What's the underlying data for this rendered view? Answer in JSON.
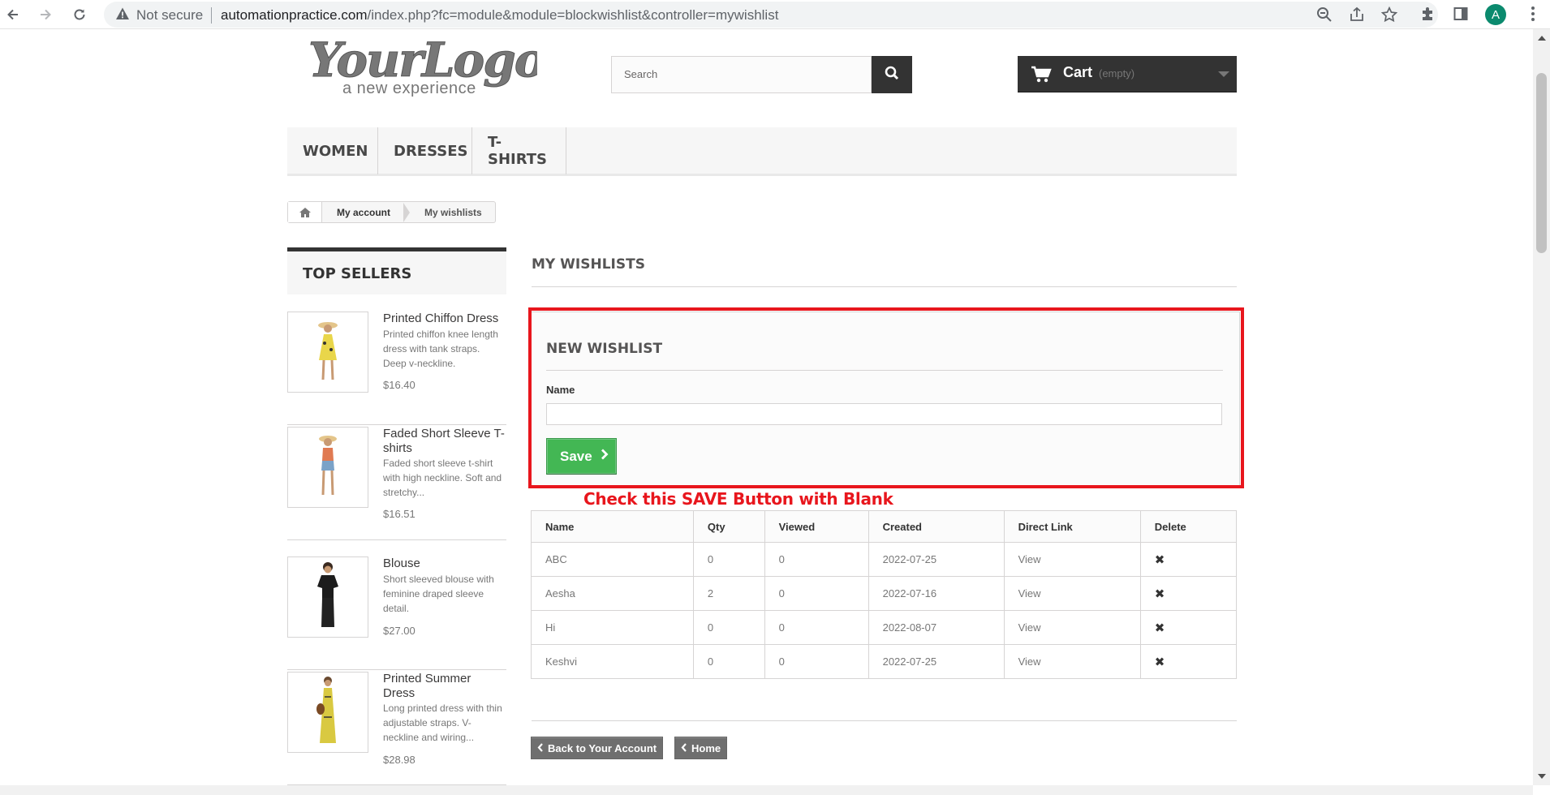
{
  "browser": {
    "security_label": "Not secure",
    "url_host": "automationpractice.com",
    "url_path": "/index.php?fc=module&module=blockwishlist&controller=mywishlist",
    "avatar_letter": "A"
  },
  "header": {
    "logo_main": "YourLogo",
    "logo_sub": "a new experience",
    "search_placeholder": "Search",
    "cart_label": "Cart",
    "cart_status": "(empty)"
  },
  "menu": [
    "WOMEN",
    "DRESSES",
    "T-SHIRTS"
  ],
  "breadcrumb": [
    "My account",
    "My wishlists"
  ],
  "sidebar": {
    "title": "TOP SELLERS",
    "products": [
      {
        "name": "Printed Chiffon Dress",
        "desc": "Printed chiffon knee length dress with tank straps. Deep v-neckline.",
        "price": "$16.40",
        "dress": "#e9d64a"
      },
      {
        "name": "Faded Short Sleeve T-shirts",
        "desc": "Faded short sleeve t-shirt with high neckline. Soft and stretchy...",
        "price": "$16.51",
        "dress": "#e07a52"
      },
      {
        "name": "Blouse",
        "desc": "Short sleeved blouse with feminine draped sleeve detail.",
        "price": "$27.00",
        "dress": "#1c1c1c"
      },
      {
        "name": "Printed Summer Dress",
        "desc": "Long printed dress with thin adjustable straps. V-neckline and wiring...",
        "price": "$28.98",
        "dress": "#d9c941"
      }
    ]
  },
  "main": {
    "title": "MY WISHLISTS",
    "new_wishlist": {
      "title": "NEW WISHLIST",
      "name_label": "Name",
      "name_value": "",
      "save_label": "Save"
    },
    "annotation": "Check  this SAVE Button with Blank",
    "table": {
      "headers": [
        "Name",
        "Qty",
        "Viewed",
        "Created",
        "Direct Link",
        "Delete"
      ],
      "rows": [
        {
          "name": "ABC",
          "qty": "0",
          "viewed": "0",
          "created": "2022-07-25",
          "link": "View"
        },
        {
          "name": "Aesha",
          "qty": "2",
          "viewed": "0",
          "created": "2022-07-16",
          "link": "View"
        },
        {
          "name": "Hi",
          "qty": "0",
          "viewed": "0",
          "created": "2022-08-07",
          "link": "View"
        },
        {
          "name": "Keshvi",
          "qty": "0",
          "viewed": "0",
          "created": "2022-07-25",
          "link": "View"
        }
      ]
    },
    "back_account_label": "Back to Your Account",
    "home_label": "Home"
  },
  "colors": {
    "annotation_red": "#e8161d",
    "save_green": "#43b754",
    "dark": "#333333"
  }
}
